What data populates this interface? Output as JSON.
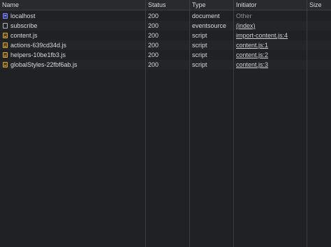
{
  "columns": {
    "name": "Name",
    "status": "Status",
    "type": "Type",
    "initiator": "Initiator",
    "size": "Size"
  },
  "requests": [
    {
      "name": "localhost",
      "status": "200",
      "type": "document",
      "initiator": "Other",
      "icon": "document-icon"
    },
    {
      "name": "subscribe",
      "status": "200",
      "type": "eventsource",
      "initiator": "(index)",
      "icon": "eventsource-icon"
    },
    {
      "name": "content.js",
      "status": "200",
      "type": "script",
      "initiator": "import-content.js:4",
      "icon": "script-icon"
    },
    {
      "name": "actions-639cd34d.js",
      "status": "200",
      "type": "script",
      "initiator": "content.js:1",
      "icon": "script-icon"
    },
    {
      "name": "helpers-10be1fb3.js",
      "status": "200",
      "type": "script",
      "initiator": "content.js:2",
      "icon": "script-icon"
    },
    {
      "name": "globalStyles-22fbf6ab.js",
      "status": "200",
      "type": "script",
      "initiator": "content.js:3",
      "icon": "script-icon"
    }
  ],
  "colors": {
    "background": "#202124",
    "header": "#292a2d",
    "divider": "#3b3d40",
    "script_icon": "#d9a53a",
    "document_icon": "#7b83f0"
  }
}
